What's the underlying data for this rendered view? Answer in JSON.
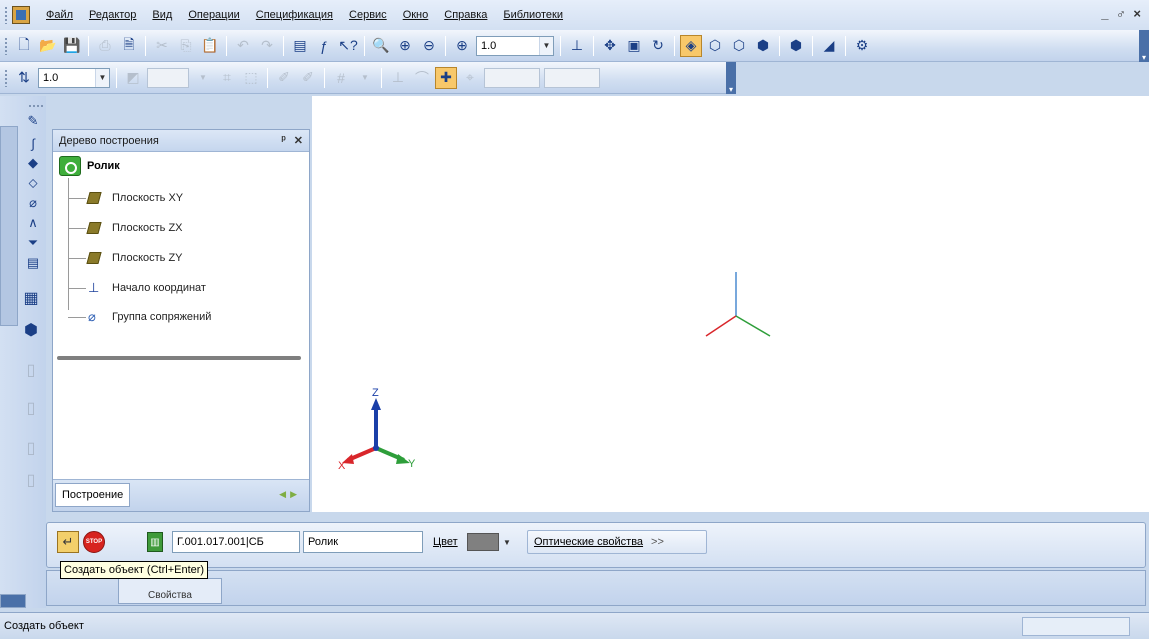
{
  "menu": {
    "items": [
      {
        "label": "Файл"
      },
      {
        "label": "Редактор"
      },
      {
        "label": "Вид"
      },
      {
        "label": "Операции"
      },
      {
        "label": "Спецификация"
      },
      {
        "label": "Сервис"
      },
      {
        "label": "Окно"
      },
      {
        "label": "Справка"
      },
      {
        "label": "Библиотеки"
      }
    ],
    "window_controls": "_ ♂ ×"
  },
  "toolbar1": {
    "zoom_value": "1.0"
  },
  "toolbar2": {
    "step_value": "1.0"
  },
  "tree": {
    "title": "Дерево построения",
    "pin_icon": "pin-icon",
    "close_icon": "close-icon",
    "root": "Ролик",
    "nodes": [
      {
        "label": "Плоскость XY",
        "icon": "plane-icon"
      },
      {
        "label": "Плоскость ZX",
        "icon": "plane-icon"
      },
      {
        "label": "Плоскость ZY",
        "icon": "plane-icon"
      },
      {
        "label": "Начало координат",
        "icon": "origin-icon"
      },
      {
        "label": "Группа сопряжений",
        "icon": "paperclip-icon"
      }
    ],
    "tab": "Построение"
  },
  "viewport": {
    "axis_labels": {
      "x": "X",
      "y": "Y",
      "z": "Z"
    },
    "colors": {
      "x": "#d9262b",
      "y": "#2e9e3a",
      "z": "#1a3fa8"
    }
  },
  "properties": {
    "designation": "Г.001.017.001|СБ",
    "name": "Ролик",
    "color_label": "Цвет",
    "color_value": "#808080",
    "optic_label": "Оптические свойства",
    "optic_suffix": ">>",
    "tooltip": "Создать объект (Ctrl+Enter)",
    "tab": "Свойства"
  },
  "status": {
    "text": "Создать объект"
  }
}
